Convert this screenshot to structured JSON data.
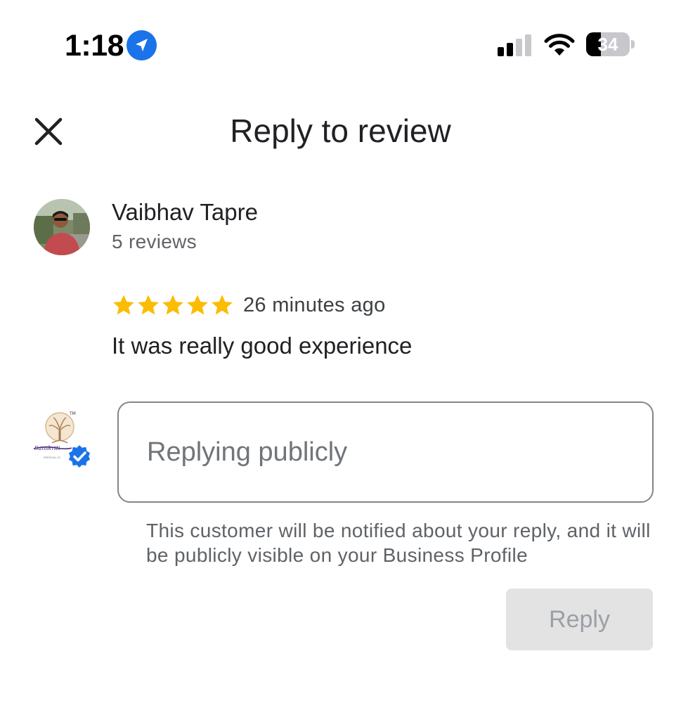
{
  "status_bar": {
    "time": "1:18",
    "battery_level": "34",
    "battery_fraction": 0.34,
    "icons": [
      "location-arrow-icon",
      "cellular-signal-icon",
      "wifi-icon",
      "battery-icon"
    ]
  },
  "header": {
    "title": "Reply to review",
    "close_icon": "close-icon"
  },
  "review": {
    "reviewer_name": "Vaibhav Tapre",
    "reviewer_meta": "5 reviews",
    "rating": 5,
    "rating_max": 5,
    "time_ago": "26 minutes ago",
    "text": "It was really good experience"
  },
  "reply": {
    "placeholder": "Replying publicly",
    "value": "",
    "notice": "This customer will be notified about your reply, and it will be publicly visible on your Business Profile",
    "button_label": "Reply",
    "button_enabled": false
  },
  "colors": {
    "star": "#fbbc04",
    "accent_blue": "#1a73e8",
    "disabled_button_bg": "#e3e3e3",
    "disabled_button_text": "#9aa0a6"
  }
}
